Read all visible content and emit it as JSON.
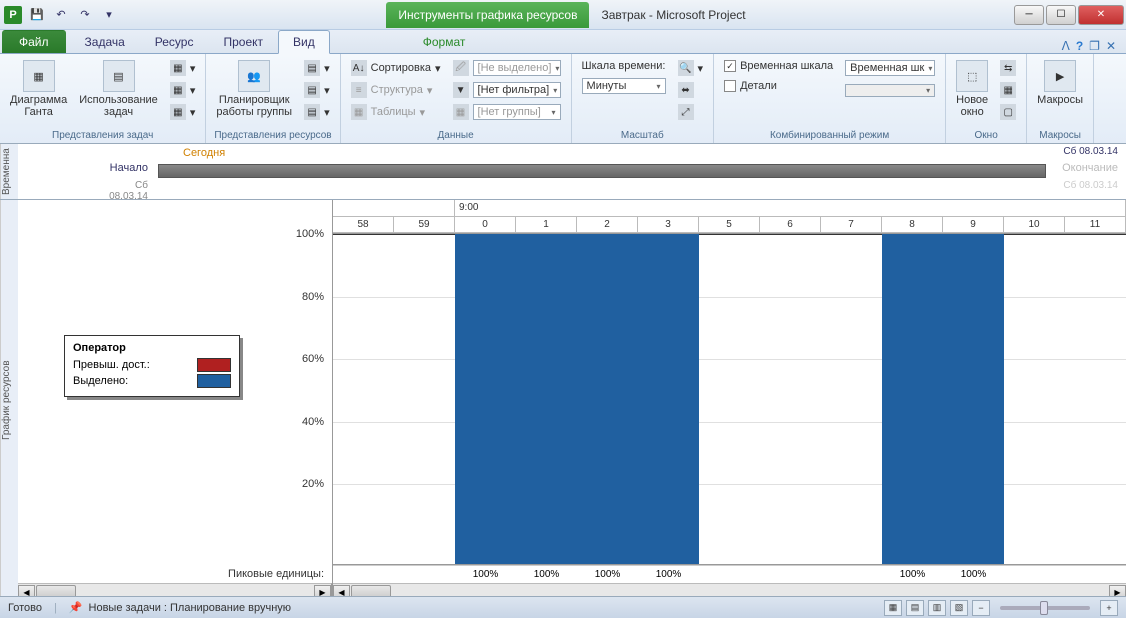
{
  "app": {
    "letter": "P",
    "title": "Завтрак - Microsoft Project"
  },
  "contextual_tab": "Инструменты графика ресурсов",
  "ribbon_tabs": {
    "file": "Файл",
    "task": "Задача",
    "resource": "Ресурс",
    "project": "Проект",
    "view": "Вид",
    "format": "Формат"
  },
  "ribbon": {
    "gantt": "Диаграмма\nГанта",
    "task_usage": "Использование\nзадач",
    "team_planner": "Планировщик\nработы группы",
    "sort": "Сортировка",
    "structure": "Структура",
    "tables": "Таблицы",
    "no_highlight": "[Не выделено]",
    "no_filter": "[Нет фильтра]",
    "no_group": "[Нет группы]",
    "timescale_label": "Шкала времени:",
    "timescale_value": "Минуты",
    "timeline_check": "Временная шкала",
    "timeline_combo": "Временная шк",
    "details_check": "Детали",
    "new_window": "Новое\nокно",
    "macros": "Макросы",
    "group_task_views": "Представления задач",
    "group_resource_views": "Представления ресурсов",
    "group_data": "Данные",
    "group_zoom": "Масштаб",
    "group_combined": "Комбинированный режим",
    "group_window": "Окно",
    "group_macros": "Макросы"
  },
  "timeline": {
    "side_label": "Временна",
    "start": "Начало",
    "start_date": "Сб 08.03.14",
    "today": "Сегодня",
    "end": "Окончание",
    "end_date": "Сб 08.03.14",
    "top_date": "Сб 08.03.14"
  },
  "side_label_main": "График ресурсов",
  "legend": {
    "title": "Оператор",
    "overalloc": "Превыш. дост.:",
    "allocated": "Выделено:",
    "color_over": "#b02020",
    "color_alloc": "#2060a0"
  },
  "peak_label": "Пиковые единицы:",
  "chart_data": {
    "type": "bar",
    "title": "",
    "xlabel": "",
    "ylabel": "",
    "time_top_label": "9:00",
    "minutes": [
      "58",
      "59",
      "0",
      "1",
      "2",
      "3",
      "5",
      "6",
      "7",
      "8",
      "9",
      "10",
      "11"
    ],
    "y_ticks": [
      "100%",
      "80%",
      "60%",
      "40%",
      "20%"
    ],
    "ylim": [
      0,
      100
    ],
    "bars": [
      {
        "minute": "0",
        "value": 100
      },
      {
        "minute": "1",
        "value": 100
      },
      {
        "minute": "2",
        "value": 100
      },
      {
        "minute": "3",
        "value": 100
      },
      {
        "minute": "8",
        "value": 100
      },
      {
        "minute": "9",
        "value": 100
      }
    ],
    "peak_values": {
      "0": "100%",
      "1": "100%",
      "2": "100%",
      "3": "100%",
      "8": "100%",
      "9": "100%"
    }
  },
  "status": {
    "ready": "Готово",
    "newtasks": "Новые задачи : Планирование вручную"
  }
}
